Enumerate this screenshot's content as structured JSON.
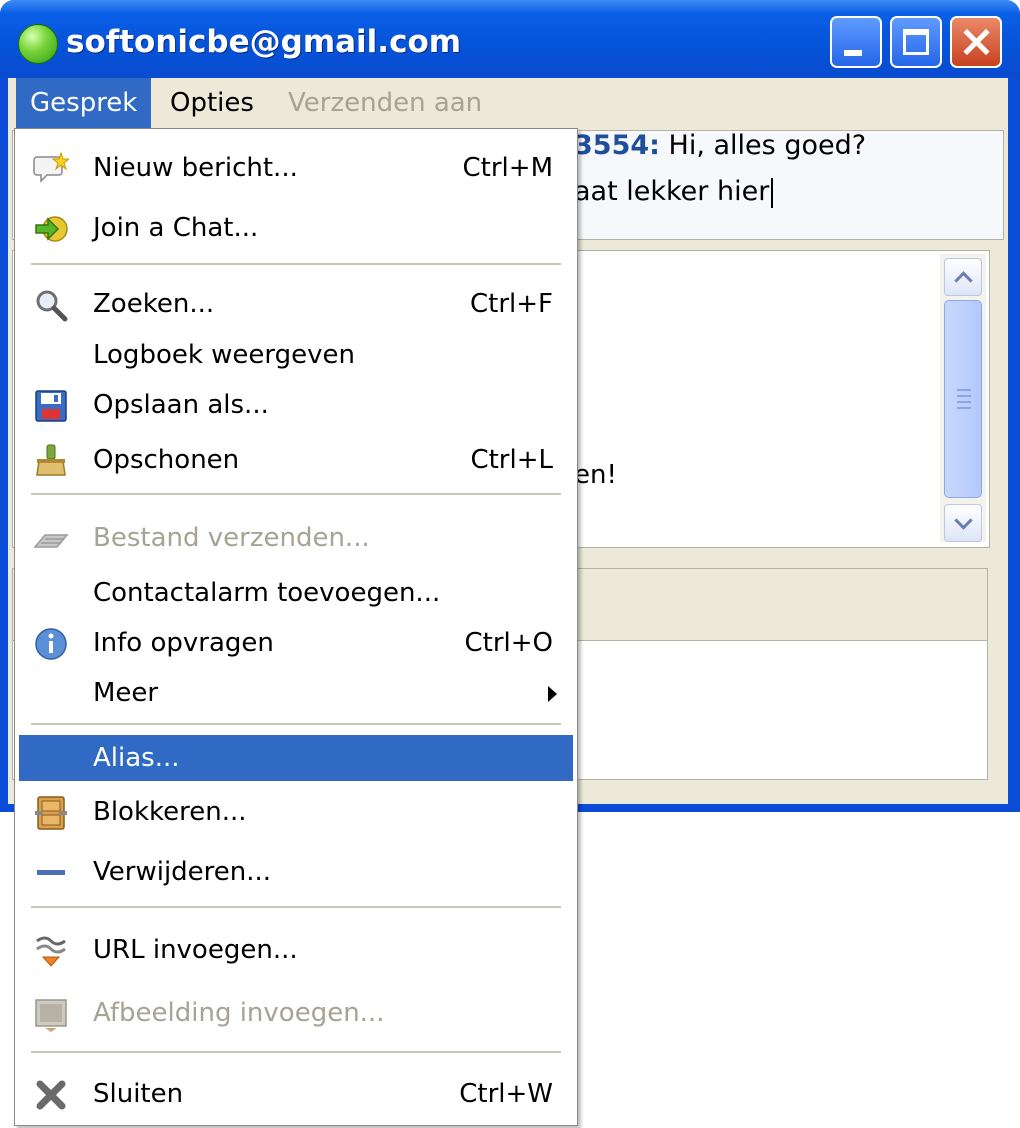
{
  "window": {
    "title": "softonicbe@gmail.com"
  },
  "menubar": {
    "items": [
      {
        "label": "Gesprek"
      },
      {
        "label": "Opties"
      },
      {
        "label": "Verzenden aan"
      }
    ]
  },
  "chat": {
    "line1_nick": "3554:",
    "line1_text": " Hi, alles goed?",
    "line2_text": "aat lekker hier",
    "toolbar_text": "en!"
  },
  "menu": {
    "items": [
      {
        "label": "Nieuw bericht...",
        "shortcut": "Ctrl+M",
        "icon": "new-message-icon"
      },
      {
        "label": "Join a Chat...",
        "shortcut": "",
        "icon": "join-chat-icon"
      },
      {
        "label": "Zoeken...",
        "shortcut": "Ctrl+F",
        "icon": "search-icon"
      },
      {
        "label": "Logboek weergeven",
        "shortcut": ""
      },
      {
        "label": "Opslaan als...",
        "shortcut": "",
        "icon": "save-icon"
      },
      {
        "label": "Opschonen",
        "shortcut": "Ctrl+L",
        "icon": "clear-icon"
      },
      {
        "label": "Bestand verzenden...",
        "shortcut": "",
        "icon": "send-file-icon"
      },
      {
        "label": "Contactalarm toevoegen...",
        "shortcut": ""
      },
      {
        "label": "Info opvragen",
        "shortcut": "Ctrl+O",
        "icon": "info-icon"
      },
      {
        "label": "Meer",
        "shortcut": ""
      },
      {
        "label": "Alias...",
        "shortcut": ""
      },
      {
        "label": "Blokkeren...",
        "shortcut": "",
        "icon": "block-icon"
      },
      {
        "label": "Verwijderen...",
        "shortcut": "",
        "icon": "remove-icon"
      },
      {
        "label": "URL invoegen...",
        "shortcut": "",
        "icon": "insert-link-icon"
      },
      {
        "label": "Afbeelding invoegen...",
        "shortcut": "",
        "icon": "insert-image-icon"
      },
      {
        "label": "Sluiten",
        "shortcut": "Ctrl+W",
        "icon": "close-icon"
      }
    ]
  },
  "colors": {
    "titlebar": "#0553d8",
    "highlight": "#316ac5",
    "disabled_text": "#a7a394",
    "menubar": "#ece9d8"
  }
}
